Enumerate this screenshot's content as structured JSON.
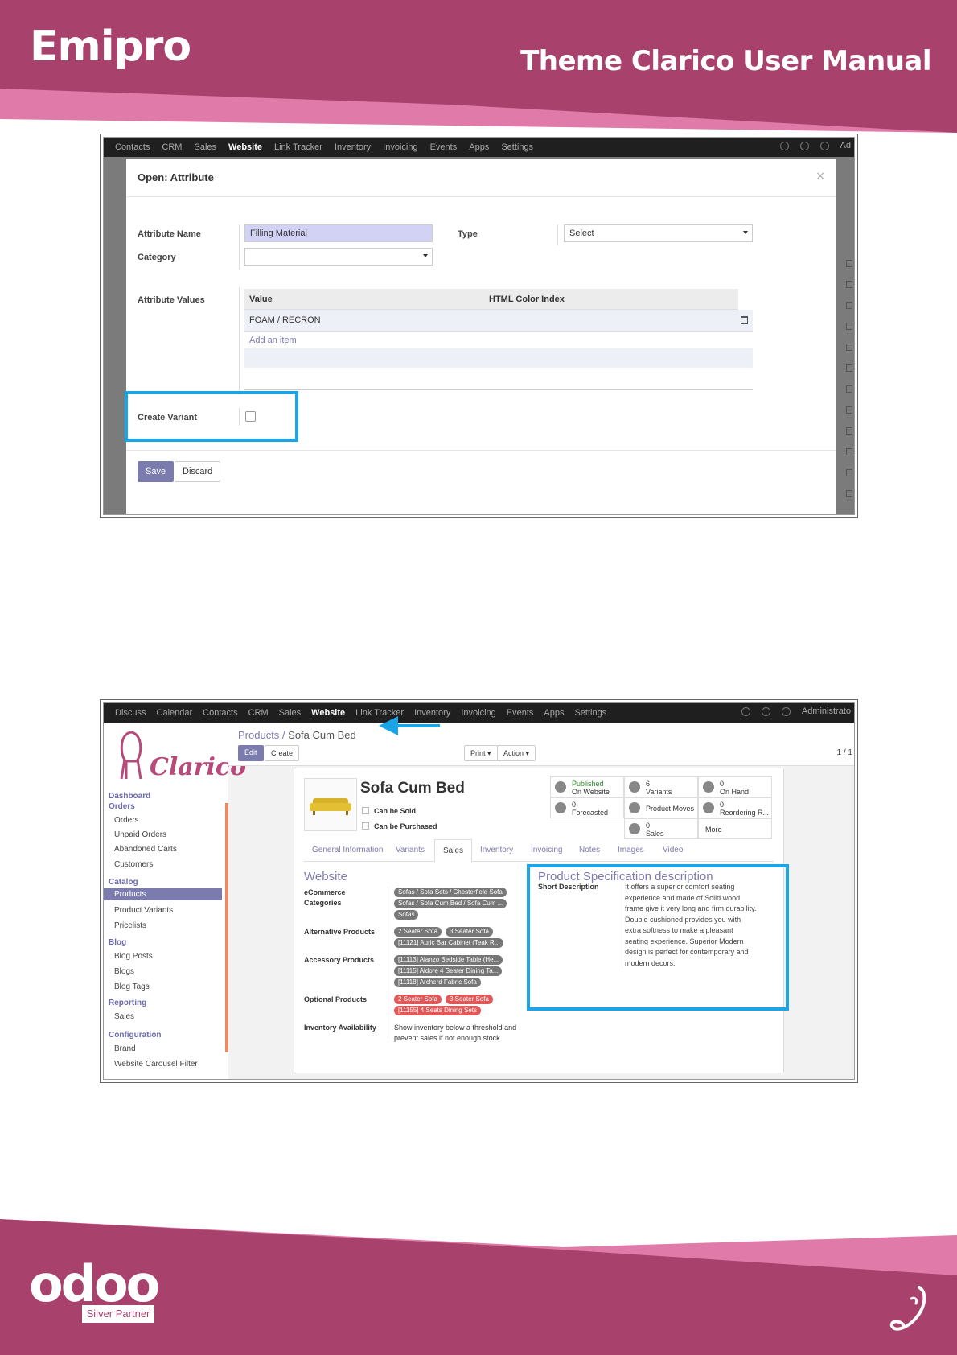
{
  "header": {
    "brand": "Emipro",
    "manual_title": "Theme Clarico User Manual"
  },
  "colors": {
    "brand": "#a8426c",
    "accent_pink": "#e07aa8",
    "odoo_primary": "#7c7bad",
    "highlight": "#1ba4e6"
  },
  "screenshot1": {
    "nav": [
      "Contacts",
      "CRM",
      "Sales",
      "Website",
      "Link Tracker",
      "Inventory",
      "Invoicing",
      "Events",
      "Apps",
      "Settings"
    ],
    "nav_active": "Website",
    "nav_user": "Ad",
    "modal": {
      "title": "Open: Attribute",
      "close": "×",
      "attribute_name_label": "Attribute Name",
      "attribute_name_value": "Filling Material",
      "category_label": "Category",
      "type_label": "Type",
      "type_value": "Select",
      "attribute_values_label": "Attribute Values",
      "table_headers": [
        "Value",
        "HTML Color Index"
      ],
      "rows": [
        "FOAM / RECRON"
      ],
      "add_item": "Add an item",
      "create_variant_label": "Create Variant",
      "save": "Save",
      "discard": "Discard"
    }
  },
  "screenshot2": {
    "nav": [
      "Discuss",
      "Calendar",
      "Contacts",
      "CRM",
      "Sales",
      "Website",
      "Link Tracker",
      "Inventory",
      "Invoicing",
      "Events",
      "Apps",
      "Settings"
    ],
    "nav_active": "Website",
    "nav_user": "Administrato",
    "logo": "Clarico",
    "sidebar": {
      "dashboard": "Dashboard",
      "orders_h": "Orders",
      "orders": [
        "Orders",
        "Unpaid Orders",
        "Abandoned Carts",
        "Customers"
      ],
      "catalog_h": "Catalog",
      "catalog": [
        "Products",
        "Product Variants",
        "Pricelists"
      ],
      "blog_h": "Blog",
      "blog": [
        "Blog Posts",
        "Blogs",
        "Blog Tags"
      ],
      "reporting_h": "Reporting",
      "reporting": [
        "Sales"
      ],
      "config_h": "Configuration",
      "config": [
        "Brand",
        "Website Carousel Filter"
      ]
    },
    "breadcrumb_root": "Products /",
    "breadcrumb_current": "Sofa Cum Bed",
    "buttons": {
      "edit": "Edit",
      "create": "Create",
      "print": "Print ▾",
      "action": "Action ▾"
    },
    "pager": "1 / 1",
    "product": {
      "name": "Sofa Cum Bed",
      "can_be_sold": "Can be Sold",
      "can_be_purchased": "Can be Purchased"
    },
    "stats": {
      "published": "Published",
      "on_website": "On Website",
      "variants_count": "6",
      "variants": "Variants",
      "on_hand_count": "0",
      "on_hand": "On Hand",
      "forecasted_count": "0",
      "forecasted": "Forecasted",
      "product_moves": "Product Moves",
      "reordering_count": "0",
      "reordering": "Reordering R...",
      "sales_count": "0",
      "sales": "Sales",
      "more": "More"
    },
    "tabs": [
      "General Information",
      "Variants",
      "Sales",
      "Inventory",
      "Invoicing",
      "Notes",
      "Images",
      "Video"
    ],
    "tab_active": "Sales",
    "website_section": {
      "title": "Website",
      "ecommerce_label": "eCommerce Categories",
      "ecommerce_tags": [
        "Sofas / Sofa Sets / Chesterfield Sofa",
        "Sofas / Sofa Cum Bed / Sofa Cum ...",
        "Sofas"
      ],
      "alternative_label": "Alternative Products",
      "alternative_tags": [
        "2 Seater Sofa",
        "3 Seater Sofa",
        "[11121] Auric Bar Cabinet (Teak R..."
      ],
      "accessory_label": "Accessory Products",
      "accessory_tags": [
        "[11113] Alanzo Bedside Table (He...",
        "[11115] Aldore 4 Seater Dining Ta...",
        "[11118] Archerd Fabric Sofa"
      ],
      "optional_label": "Optional Products",
      "optional_tags": [
        "2 Seater Sofa",
        "3 Seater Sofa",
        "[11155] 4 Seats Dining Sets"
      ],
      "inventory_label": "Inventory Availability",
      "inventory_value": "Show inventory below a threshold and prevent sales if not enough stock"
    },
    "spec_section": {
      "title": "Product Specification description",
      "short_label": "Short Description",
      "short_text": "It offers a superior comfort seating experience and made of Solid wood frame give it very long and firm durability. Double cushioned provides you with extra softness to make a pleasant seating experience. Superior Modern design is perfect for contemporary and modern decors."
    }
  },
  "footer": {
    "logo": "odoo",
    "partner": "Silver Partner"
  }
}
